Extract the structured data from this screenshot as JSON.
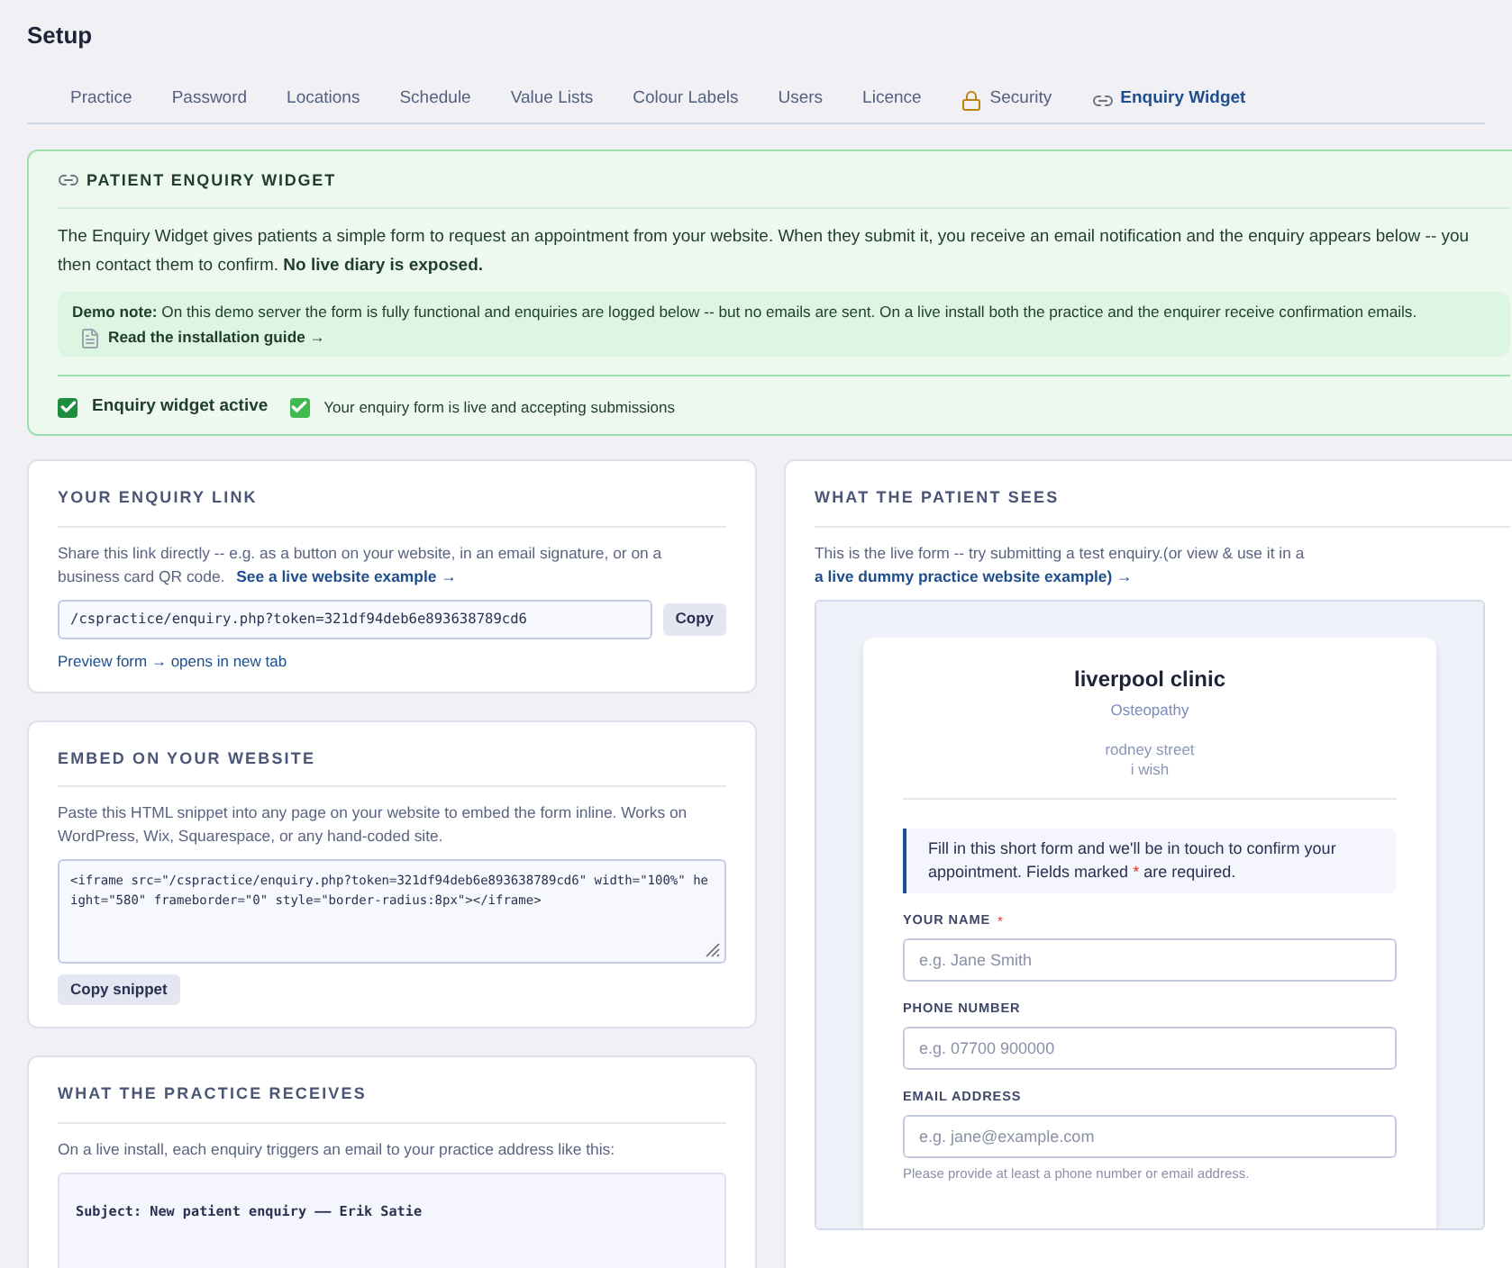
{
  "page_title": "Setup",
  "tabs": [
    {
      "label": "Practice",
      "selected": false,
      "kind": "plain"
    },
    {
      "label": "Password",
      "selected": false,
      "kind": "plain"
    },
    {
      "label": "Locations",
      "selected": false,
      "kind": "plain"
    },
    {
      "label": "Schedule",
      "selected": false,
      "kind": "plain"
    },
    {
      "label": "Value Lists",
      "selected": false,
      "kind": "plain"
    },
    {
      "label": "Colour Labels",
      "selected": false,
      "kind": "plain"
    },
    {
      "label": "Users",
      "selected": false,
      "kind": "plain"
    },
    {
      "label": "Licence",
      "selected": false,
      "kind": "plain"
    },
    {
      "label": "Security",
      "selected": false,
      "kind": "locked"
    },
    {
      "label": "Enquiry Widget",
      "selected": true,
      "kind": "linked"
    }
  ],
  "widget_panel": {
    "heading": "PATIENT ENQUIRY WIDGET",
    "description": "The Enquiry Widget gives patients a simple form to request an appointment from your website. When they submit it, you receive an email notification and the enquiry appears below -- you then contact them to confirm. **No live diary is exposed.**",
    "demo_note": "**Demo note:** On this demo server the form is fully functional and enquiries are logged below -- but no emails are sent. On a live install both the practice and the enquirer receive confirmation emails.",
    "guide_link": "Read the installation guide →",
    "active_label": "Enquiry widget active",
    "active": true,
    "status_text": "Your enquiry form is live and accepting submissions"
  },
  "link_card": {
    "heading": "YOUR ENQUIRY LINK",
    "text": "Share this link directly -- e.g. as a button on your website, in an email signature, or on a business card QR code.",
    "example_link": "See a live website example →",
    "url": "/cspractice/enquiry.php?token=321df94deb6e893638789cd6",
    "copy_button": "Copy",
    "preview_link": "Preview form → opens in new tab"
  },
  "embed_card": {
    "heading": "EMBED ON YOUR WEBSITE",
    "text": "Paste this HTML snippet into any page on your website to embed the form inline. Works on WordPress, Wix, Squarespace, or any hand-coded site.",
    "snippet": "<iframe src=\"/cspractice/enquiry.php?token=321df94deb6e893638789cd6\" width=\"100%\" height=\"580\" frameborder=\"0\" style=\"border-radius:8px\"></iframe>",
    "copy_button": "Copy snippet"
  },
  "receives_card": {
    "heading": "WHAT THE PRACTICE RECEIVES",
    "text": "On a live install, each enquiry triggers an email to your practice address like this:",
    "email_subject": "Subject: New patient enquiry —— Erik Satie"
  },
  "preview_card": {
    "heading": "WHAT THE PATIENT SEES",
    "text": "This is the live form -- try submitting a test enquiry.(or view & use it in a",
    "link": "a live dummy practice website example) →",
    "form": {
      "clinic_name": "liverpool clinic",
      "specialty": "Osteopathy",
      "address": [
        "rodney street",
        "i wish"
      ],
      "note_start": "Fill in this short form and we'll be in touch to confirm your appointment. Fields marked",
      "required_mark": "*",
      "note_end": "are required.",
      "fields": [
        {
          "label": "YOUR NAME",
          "required": true,
          "placeholder": "e.g. Jane Smith"
        },
        {
          "label": "PHONE NUMBER",
          "required": false,
          "placeholder": "e.g. 07700 900000"
        },
        {
          "label": "EMAIL ADDRESS",
          "required": false,
          "placeholder": "e.g. jane@example.com"
        }
      ],
      "hint": "Please provide at least a phone number or email address."
    }
  }
}
